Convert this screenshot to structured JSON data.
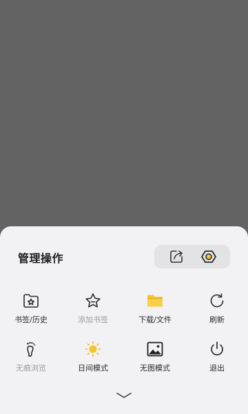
{
  "sheet": {
    "title": "管理操作",
    "header_actions": [
      {
        "icon": "share-icon"
      },
      {
        "icon": "settings-icon"
      }
    ],
    "items": [
      {
        "label": "书签/历史",
        "icon": "bookmark-folder-icon",
        "enabled": true
      },
      {
        "label": "添加书签",
        "icon": "star-icon",
        "enabled": false
      },
      {
        "label": "下载/文件",
        "icon": "folder-icon",
        "enabled": true
      },
      {
        "label": "刷新",
        "icon": "refresh-icon",
        "enabled": true
      },
      {
        "label": "无痕浏览",
        "icon": "footprint-icon",
        "enabled": false
      },
      {
        "label": "日间模式",
        "icon": "sun-icon",
        "enabled": true
      },
      {
        "label": "无图模式",
        "icon": "image-icon",
        "enabled": true
      },
      {
        "label": "退出",
        "icon": "power-icon",
        "enabled": true
      }
    ],
    "collapse_icon": "chevron-down-icon"
  },
  "colors": {
    "overlay": "#636363",
    "sheet": "#f2f2f4",
    "accent_yellow": "#f5c431",
    "icon_dark": "#2b2b2b",
    "icon_disabled": "#9a9aa2"
  }
}
